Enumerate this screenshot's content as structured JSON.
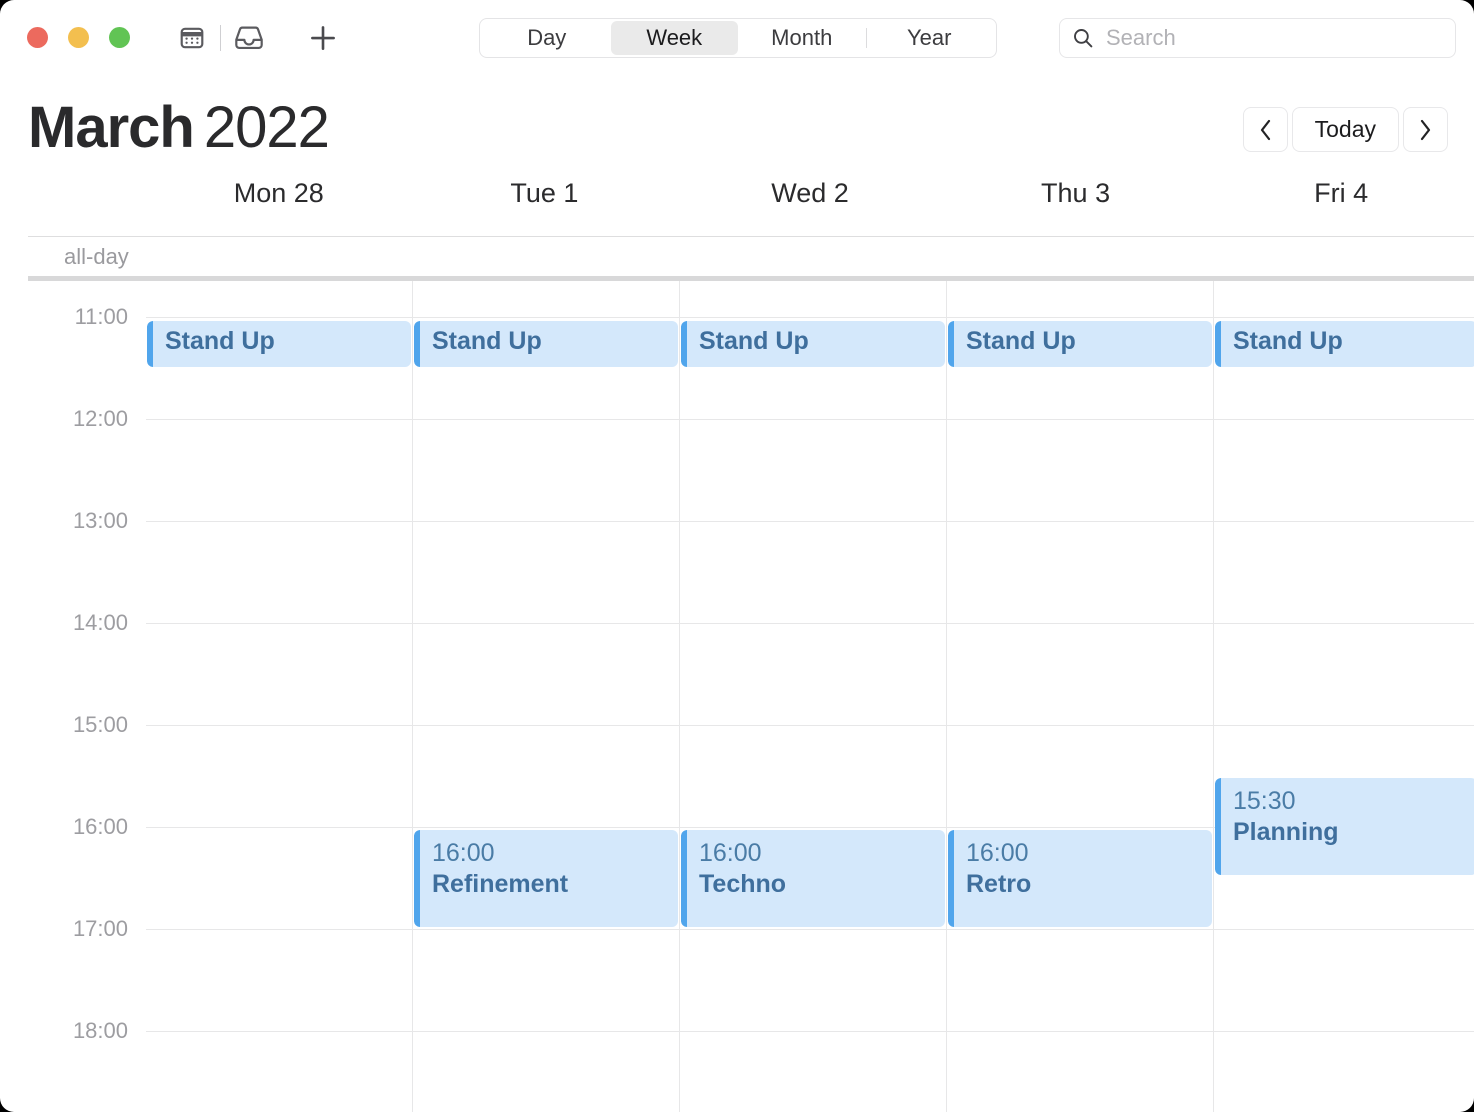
{
  "window": {
    "traffic_lights": [
      "close",
      "minimize",
      "maximize"
    ],
    "colors": {
      "close": "#ec6a5e",
      "minimize": "#f3bf4f",
      "maximize": "#61c454",
      "event_fill": "#d4e8fb",
      "event_accent": "#50a5ec",
      "event_text": "#3f6f9d",
      "selected_segment": "#eaeaea"
    }
  },
  "toolbar": {
    "icons": [
      {
        "name": "calendar-icon",
        "label": "Calendar"
      },
      {
        "name": "inbox-icon",
        "label": "Inbox"
      },
      {
        "name": "add-icon",
        "label": "+"
      }
    ],
    "view_segments": [
      {
        "label": "Day",
        "selected": false
      },
      {
        "label": "Week",
        "selected": true
      },
      {
        "label": "Month",
        "selected": false
      },
      {
        "label": "Year",
        "selected": false
      }
    ],
    "search": {
      "icon": "search-icon",
      "placeholder": "Search",
      "value": ""
    }
  },
  "header": {
    "month": "March",
    "year": "2022",
    "nav": {
      "previous_label": "‹",
      "today_label": "Today",
      "next_label": "›"
    }
  },
  "calendar": {
    "all_day_label": "all-day",
    "days": [
      {
        "label": "Mon 28"
      },
      {
        "label": "Tue 1"
      },
      {
        "label": "Wed 2"
      },
      {
        "label": "Thu 3"
      },
      {
        "label": "Fri 4"
      }
    ],
    "hours": [
      "11:00",
      "12:00",
      "13:00",
      "14:00",
      "15:00",
      "16:00",
      "17:00",
      "18:00"
    ],
    "events": [
      {
        "day": "Mon 28",
        "time": "",
        "title": "Stand Up",
        "show_time": false
      },
      {
        "day": "Tue 1",
        "time": "",
        "title": "Stand Up",
        "show_time": false
      },
      {
        "day": "Wed 2",
        "time": "",
        "title": "Stand Up",
        "show_time": false
      },
      {
        "day": "Thu 3",
        "time": "",
        "title": "Stand Up",
        "show_time": false
      },
      {
        "day": "Fri 4",
        "time": "",
        "title": "Stand Up",
        "show_time": false
      },
      {
        "day": "Tue 1",
        "time": "16:00",
        "title": "Refinement",
        "show_time": true
      },
      {
        "day": "Wed 2",
        "time": "16:00",
        "title": "Techno",
        "show_time": true
      },
      {
        "day": "Thu 3",
        "time": "16:00",
        "title": "Retro",
        "show_time": true
      },
      {
        "day": "Fri 4",
        "time": "15:30",
        "title": "Planning",
        "show_time": true
      }
    ]
  }
}
